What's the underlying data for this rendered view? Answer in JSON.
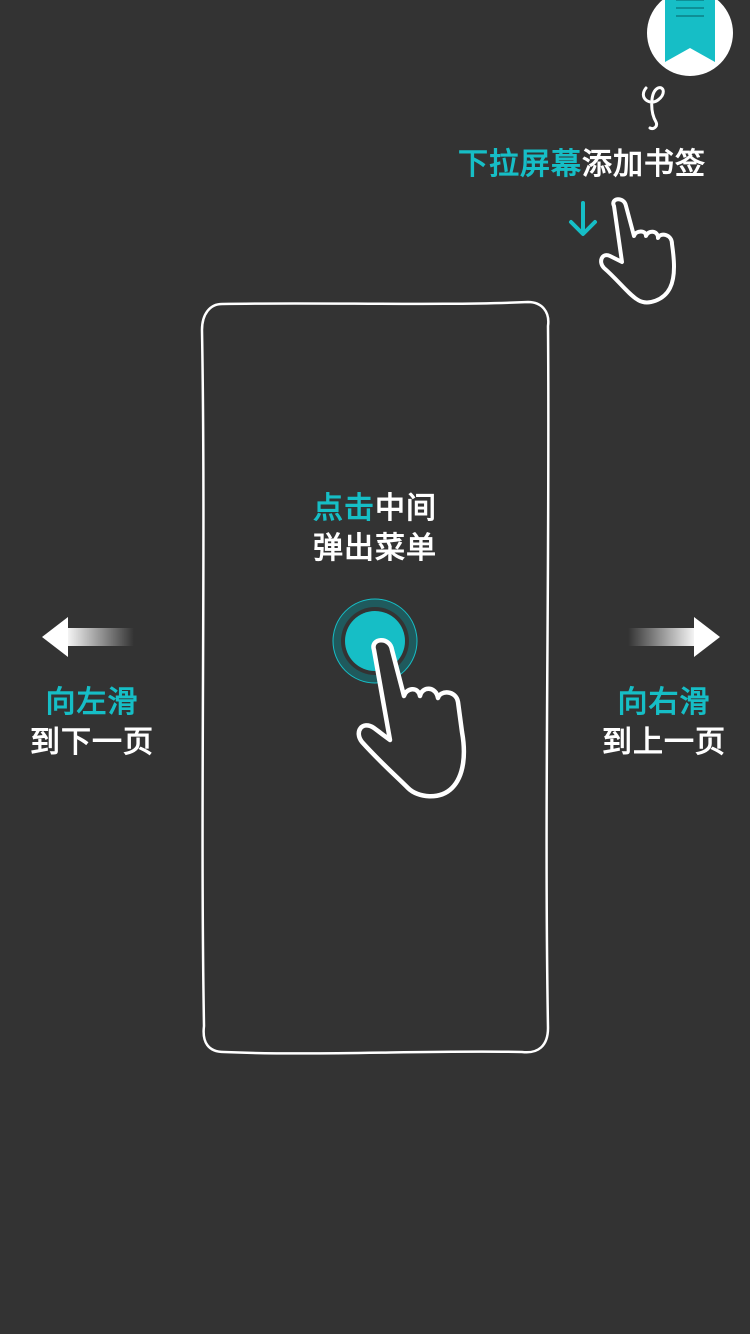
{
  "top_hint": {
    "action_text": "下拉屏幕",
    "result_text": "添加书签"
  },
  "center_hint": {
    "line1_action": "点击",
    "line1_rest": "中间",
    "line2": "弹出菜单"
  },
  "left_hint": {
    "action_text": "向左滑",
    "result_text": "到下一页"
  },
  "right_hint": {
    "action_text": "向右滑",
    "result_text": "到上一页"
  },
  "colors": {
    "background": "#333333",
    "accent": "#16BEC6",
    "text": "#FFFFFF"
  },
  "icons": {
    "bookmark": "bookmark-icon",
    "tap": "tap-hand-icon",
    "pull": "pull-down-hand-icon",
    "arrow_down": "arrow-down-icon",
    "swipe_left": "swipe-left-arrow-icon",
    "swipe_right": "swipe-right-arrow-icon"
  }
}
